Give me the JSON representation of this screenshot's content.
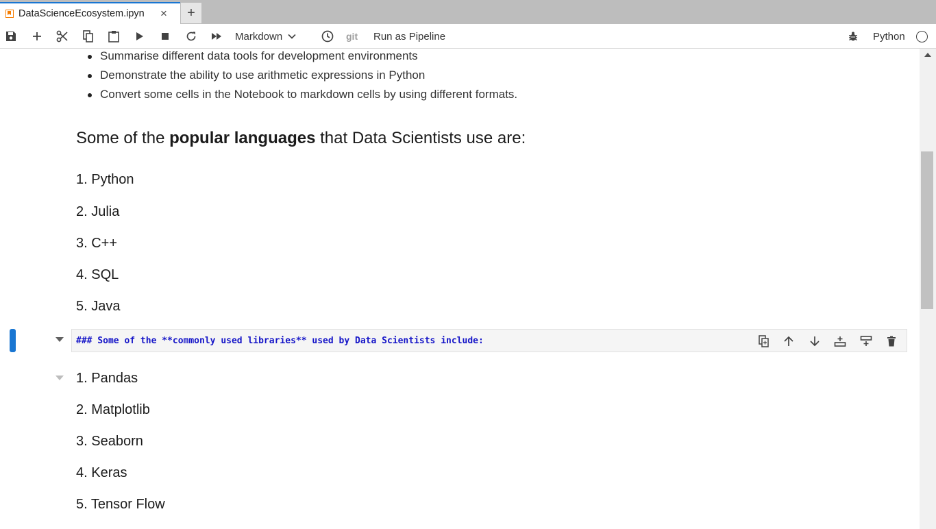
{
  "tab": {
    "title": "DataScienceEcosystem.ipyn",
    "close": "×",
    "new_tab": "+"
  },
  "toolbar": {
    "cell_type": "Markdown",
    "git": "git",
    "run_pipeline": "Run as Pipeline",
    "kernel": "Python",
    "icons": [
      "save-icon",
      "add-icon",
      "cut-icon",
      "copy-icon",
      "paste-icon",
      "run-icon",
      "stop-icon",
      "restart-icon",
      "fast-forward-icon",
      "chevron-down-icon",
      "clock-icon",
      "bug-icon",
      "circle-icon"
    ]
  },
  "notebook": {
    "objectives": [
      "Summarise different data tools for development environments",
      "Demonstrate the ability to use arithmetic expressions in Python",
      "Convert some cells in the Notebook to markdown cells by using different formats."
    ],
    "languages_heading": {
      "pre": "Some of the ",
      "bold": "popular languages",
      "post": " that Data Scientists use are:"
    },
    "languages": [
      "1. Python",
      "2. Julia",
      "3. C++",
      "4. SQL",
      "5. Java"
    ],
    "active_cell_source": "### Some of the **commonly used libraries** used by Data Scientists include:",
    "libraries": [
      "1. Pandas",
      "2. Matplotlib",
      "3. Seaborn",
      "4. Keras",
      "5. Tensor Flow"
    ],
    "cell_tools": [
      "duplicate-icon",
      "move-up-icon",
      "move-down-icon",
      "insert-above-icon",
      "insert-below-icon",
      "delete-icon"
    ]
  },
  "colors": {
    "accent": "#1976d2",
    "markdown_source": "#1515c8",
    "notebook_icon": "#f57c00"
  }
}
